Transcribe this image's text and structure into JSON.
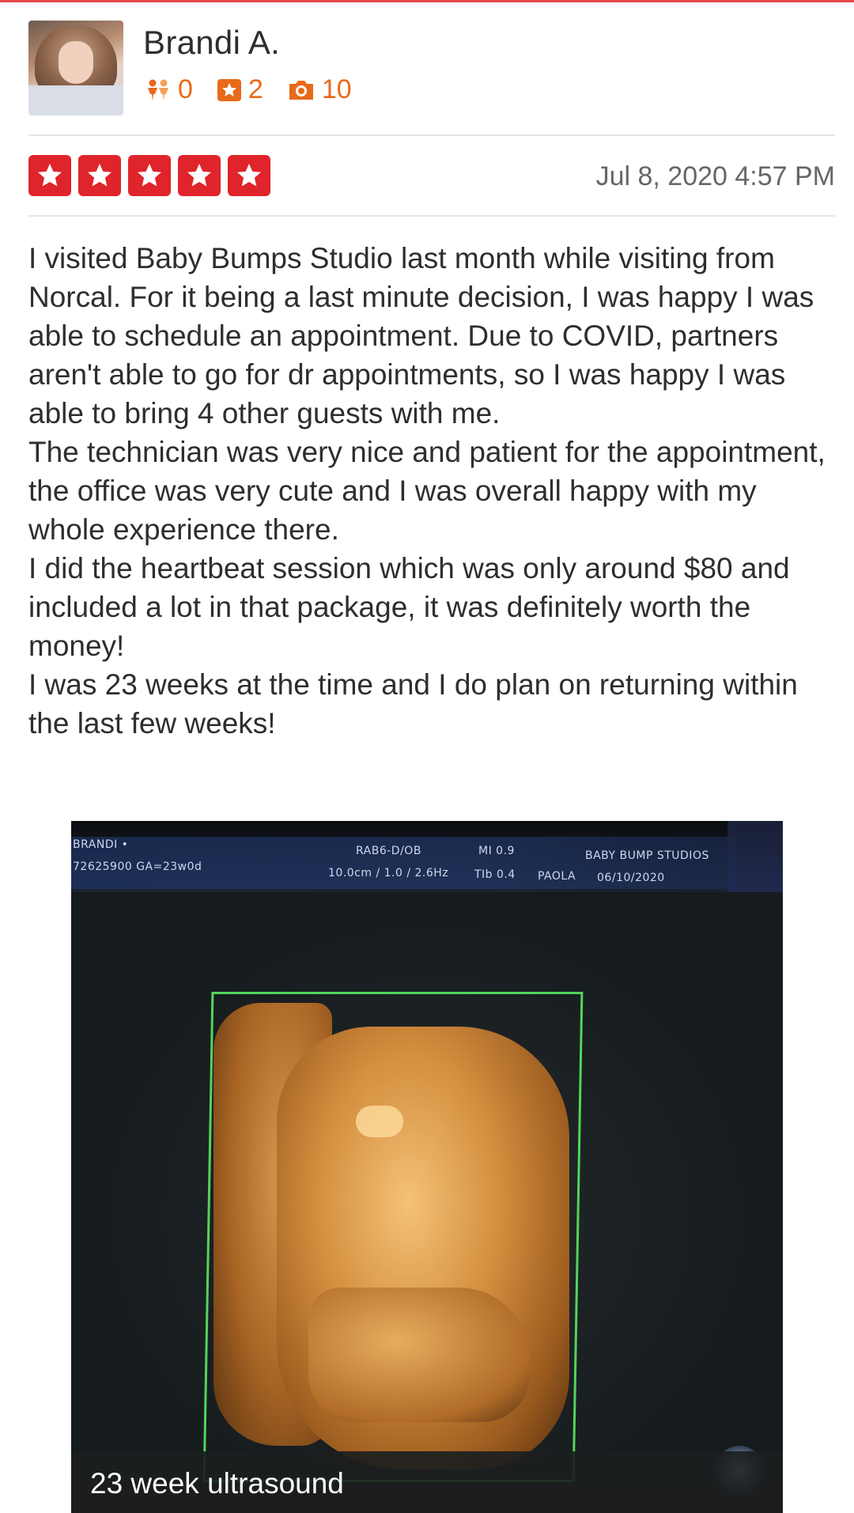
{
  "review": {
    "user": {
      "name": "Brandi A.",
      "friends_count": "0",
      "reviews_count": "2",
      "photos_count": "10"
    },
    "rating": 5,
    "date": "Jul 8, 2020 4:57 PM",
    "paragraphs": [
      "I visited Baby Bumps Studio last month while visiting from Norcal. For it being a last minute decision, I was happy I was able to schedule an appointment. Due to COVID, partners aren't able to go for dr appointments, so I was happy I was able to bring 4 other guests with me.",
      "The technician was very nice and patient for the appointment, the office was very cute and I was overall happy with my whole experience there.",
      "I did the heartbeat session which was only around $80 and included a lot in that package, it was definitely worth the money!",
      "I was 23 weeks at the time and I do plan on returning within the last few weeks!"
    ],
    "photo": {
      "caption": "23 week ultrasound",
      "overlay": {
        "line1_left": "BRANDI •",
        "line1_mid": "RAB6-D/OB",
        "line1_mi": "MI 0.9",
        "line1_right": "BABY BUMP STUDIOS",
        "line2_left": "72625900 GA=23w0d",
        "line2_mid": "10.0cm / 1.0 / 2.6Hz",
        "line2_tib": "TIb 0.4",
        "line2_name": "PAOLA",
        "line2_date": "06/10/2020"
      }
    }
  },
  "colors": {
    "star_red": "#e0242b",
    "stat_orange": "#e86a1a",
    "top_rule": "#e8474c"
  },
  "icons": [
    "friends-icon",
    "review-star-icon",
    "camera-icon",
    "star-icon"
  ]
}
